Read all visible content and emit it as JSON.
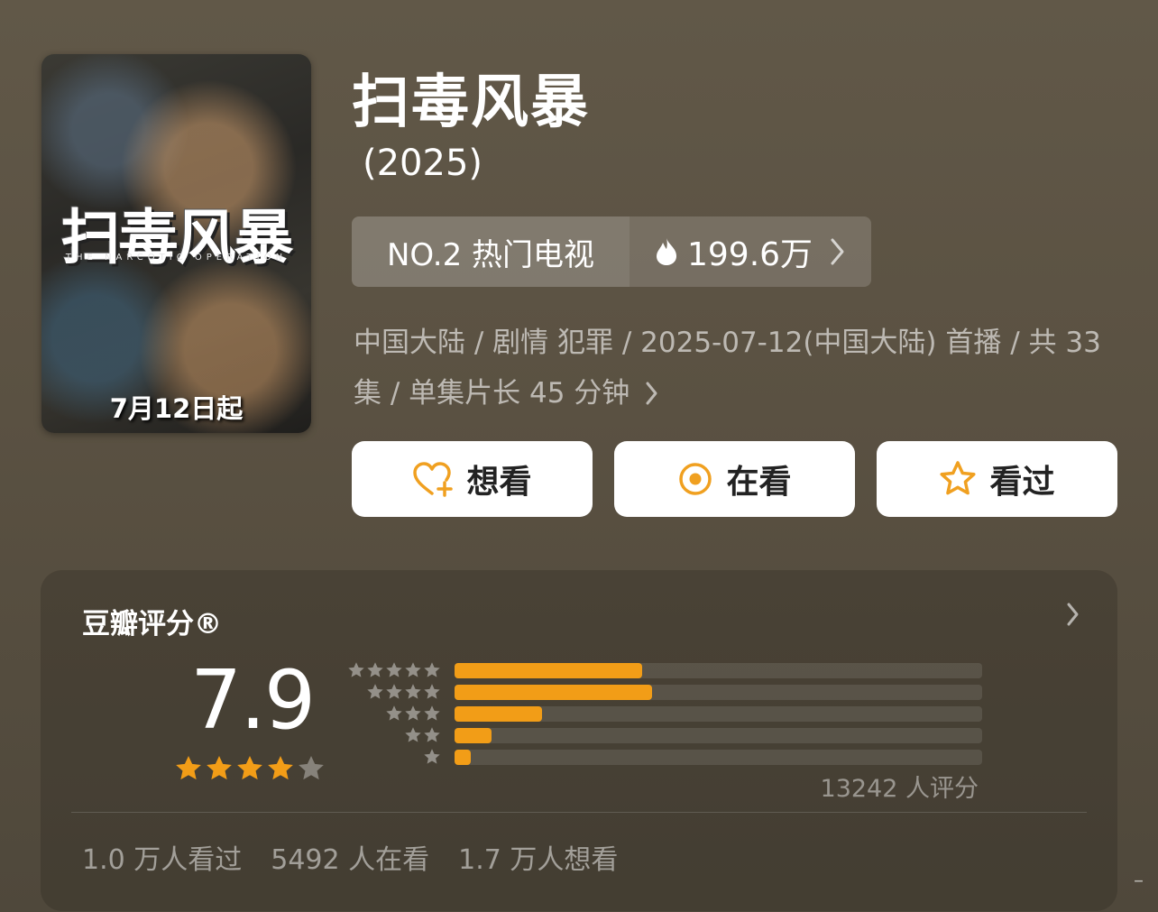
{
  "poster": {
    "title_art": "扫毒风暴",
    "english_title": "THE NARCOTIC OPERATION",
    "release_banner": "7月12日起"
  },
  "show": {
    "title": "扫毒风暴",
    "year": "(2025)"
  },
  "ranking": {
    "rank_label": "NO.2 热门电视",
    "heat_value": "199.6万"
  },
  "meta_text": "中国大陆 / 剧情 犯罪 / 2025-07-12(中国大陆) 首播 / 共 33 集 / 单集片长 45 分钟",
  "actions": [
    {
      "label": "想看",
      "icon": "heart-plus-icon"
    },
    {
      "label": "在看",
      "icon": "target-circle-icon"
    },
    {
      "label": "看过",
      "icon": "star-outline-icon"
    }
  ],
  "rating": {
    "title": "豆瓣评分®",
    "score": "7.9",
    "star_level": 4,
    "star_max": 5,
    "distribution_percent": [
      {
        "stars": 5,
        "percent": 35.5
      },
      {
        "stars": 4,
        "percent": 37.5
      },
      {
        "stars": 3,
        "percent": 16.5
      },
      {
        "stars": 2,
        "percent": 7.0
      },
      {
        "stars": 1,
        "percent": 3.0
      }
    ],
    "count_text": "13242 人评分"
  },
  "stats": {
    "watched": "1.0 万人看过",
    "watching": "5492 人在看",
    "wish": "1.7 万人想看"
  },
  "colors": {
    "accent_orange": "#f29d17",
    "icon_orange": "#f0a020",
    "background": "#5d5444"
  }
}
